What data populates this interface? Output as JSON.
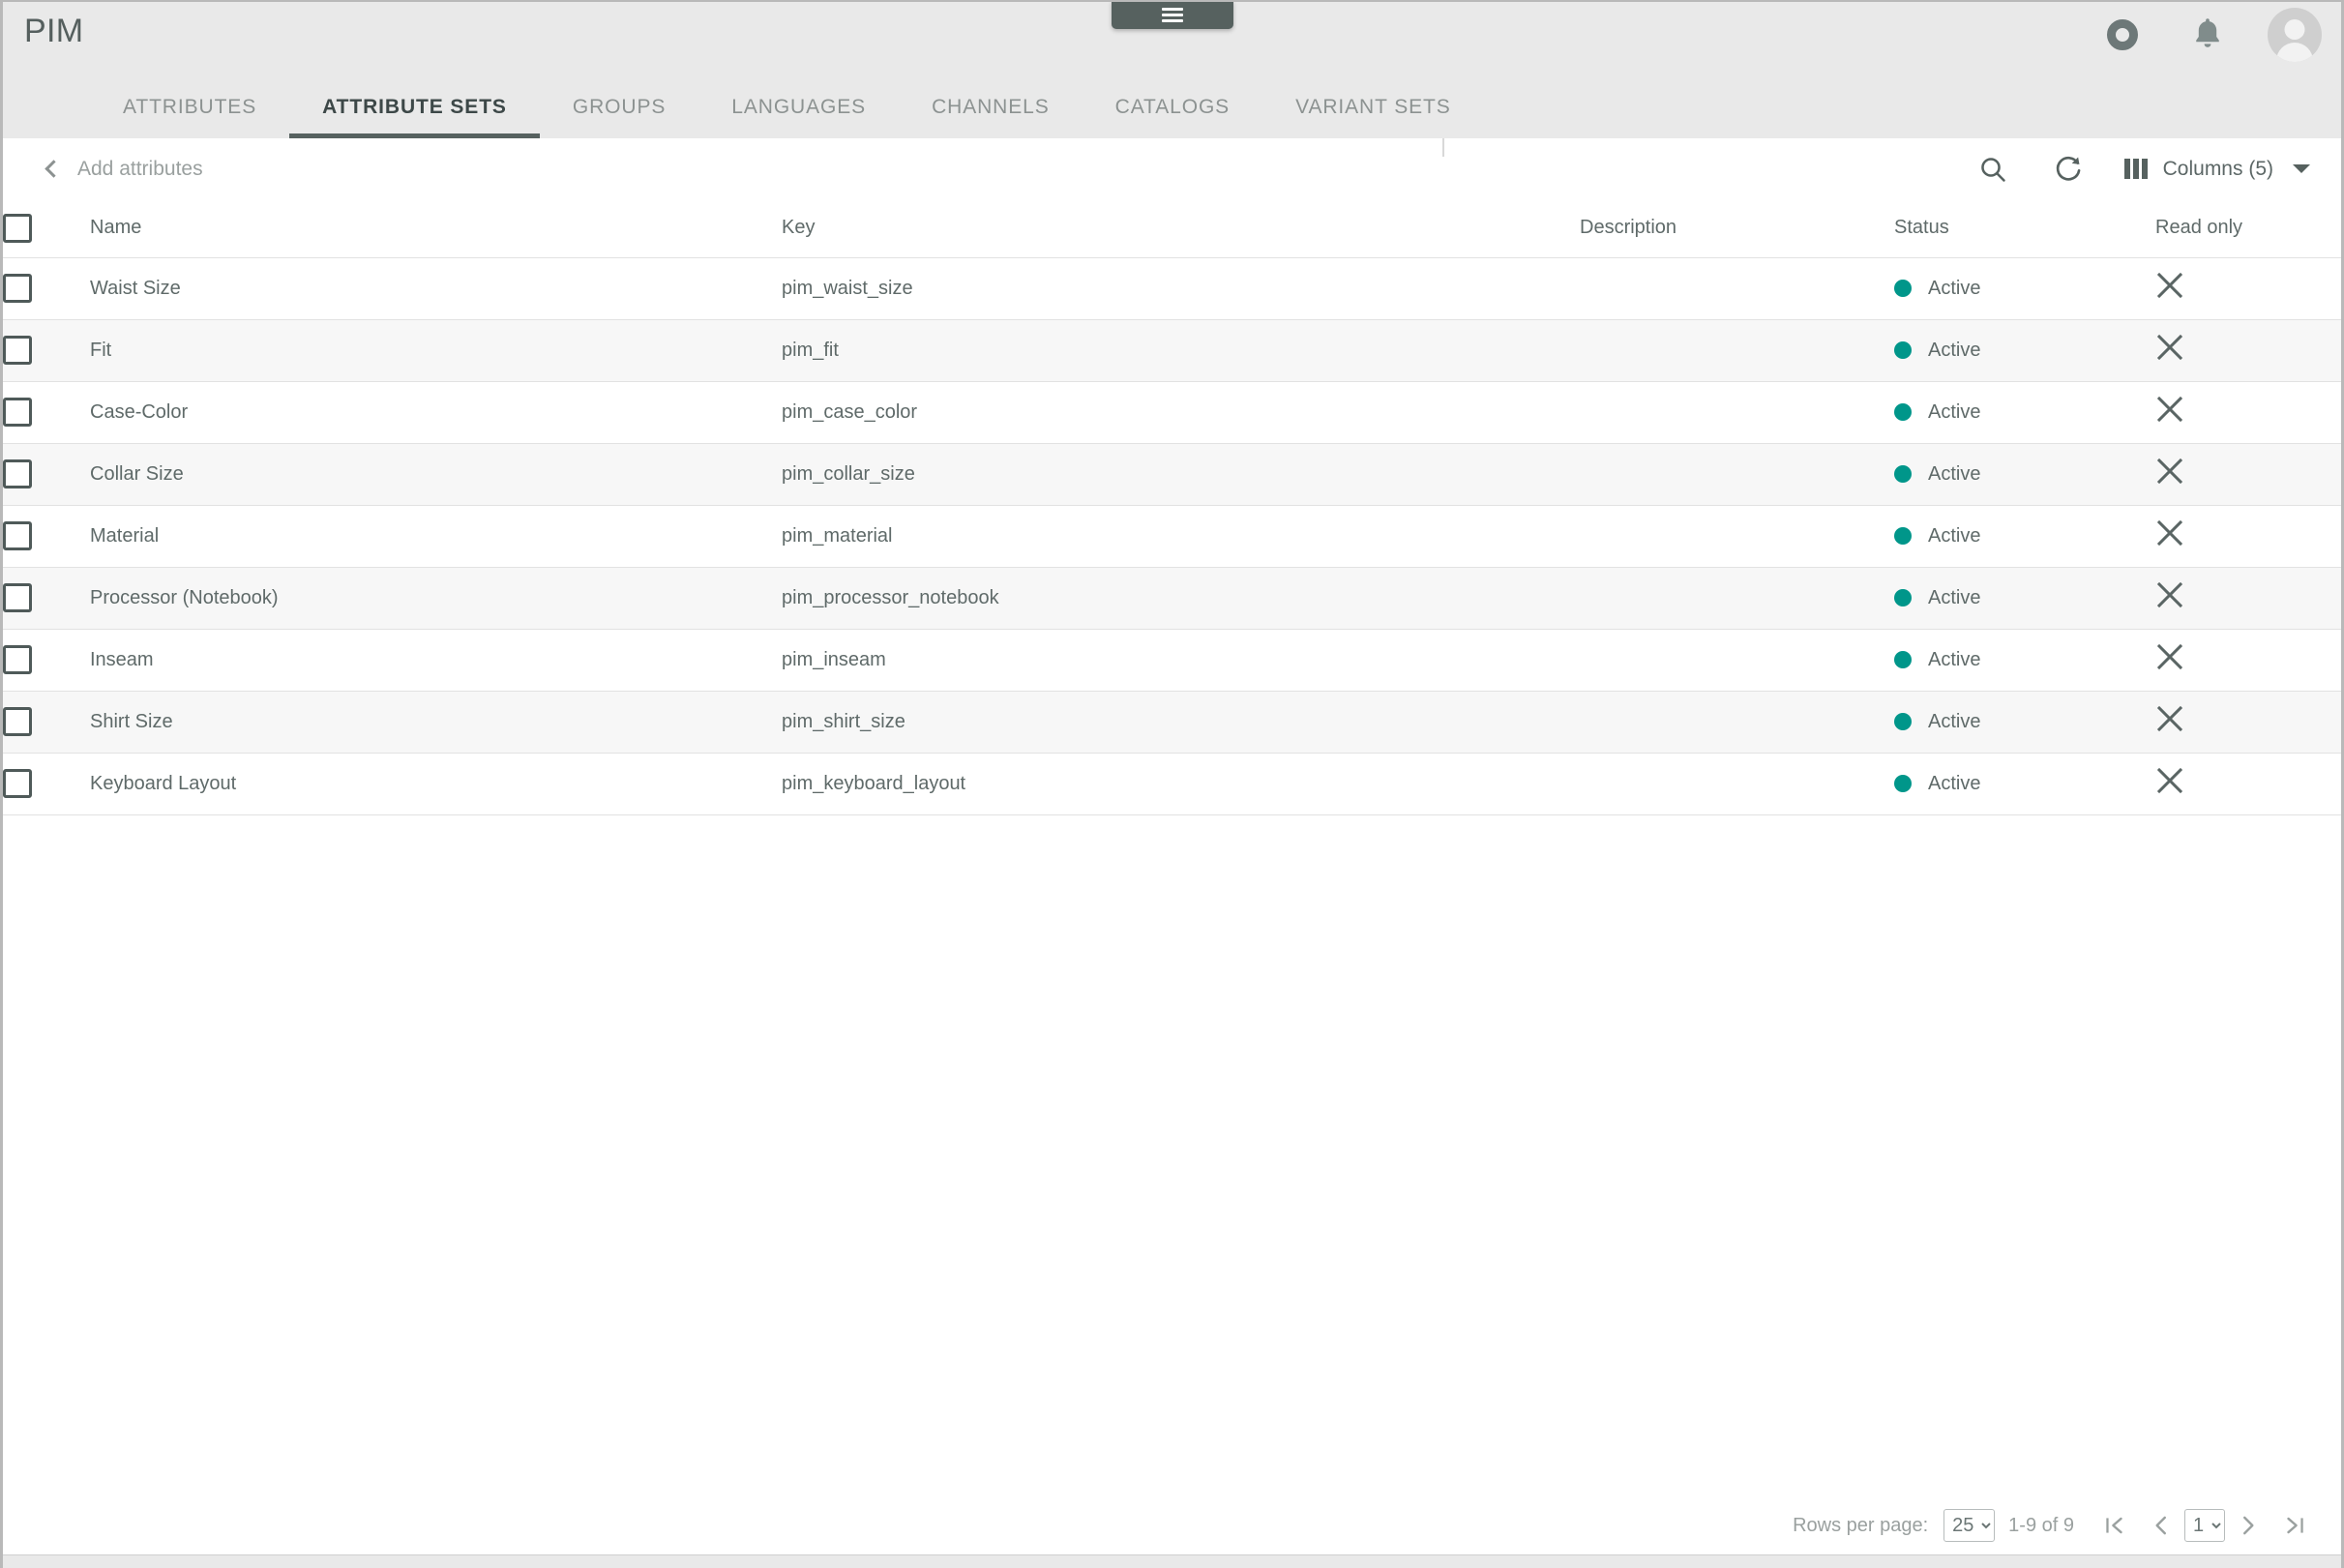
{
  "window": {
    "drag_handle_icon": "hamburger-menu-icon"
  },
  "appbar": {
    "title": "PIM",
    "actions": [
      {
        "name": "ring-icon",
        "label": ""
      },
      {
        "name": "bell-icon",
        "label": ""
      },
      {
        "name": "avatar",
        "label": ""
      }
    ]
  },
  "tabs": [
    {
      "label": "ATTRIBUTES",
      "active": false
    },
    {
      "label": "ATTRIBUTE SETS",
      "active": true
    },
    {
      "label": "GROUPS",
      "active": false
    },
    {
      "label": "LANGUAGES",
      "active": false
    },
    {
      "label": "CHANNELS",
      "active": false
    },
    {
      "label": "CATALOGS",
      "active": false
    },
    {
      "label": "VARIANT SETS",
      "active": false
    }
  ],
  "subtoolbar": {
    "back_label": "Add attributes",
    "search_icon": "search-icon",
    "refresh_icon": "refresh-icon",
    "columns_icon": "columns-icon",
    "columns_label": "Columns (5)"
  },
  "table": {
    "headers": {
      "name": "Name",
      "key": "Key",
      "description": "Description",
      "status": "Status",
      "read_only": "Read only"
    },
    "rows": [
      {
        "name": "Waist Size",
        "key": "pim_waist_size",
        "description": "",
        "status": "Active",
        "read_only": "x-icon"
      },
      {
        "name": "Fit",
        "key": "pim_fit",
        "description": "",
        "status": "Active",
        "read_only": "x-icon"
      },
      {
        "name": "Case-Color",
        "key": "pim_case_color",
        "description": "",
        "status": "Active",
        "read_only": "x-icon"
      },
      {
        "name": "Collar Size",
        "key": "pim_collar_size",
        "description": "",
        "status": "Active",
        "read_only": "x-icon"
      },
      {
        "name": "Material",
        "key": "pim_material",
        "description": "",
        "status": "Active",
        "read_only": "x-icon"
      },
      {
        "name": "Processor (Notebook)",
        "key": "pim_processor_notebook",
        "description": "",
        "status": "Active",
        "read_only": "x-icon"
      },
      {
        "name": "Inseam",
        "key": "pim_inseam",
        "description": "",
        "status": "Active",
        "read_only": "x-icon"
      },
      {
        "name": "Shirt Size",
        "key": "pim_shirt_size",
        "description": "",
        "status": "Active",
        "read_only": "x-icon"
      },
      {
        "name": "Keyboard Layout",
        "key": "pim_keyboard_layout",
        "description": "",
        "status": "Active",
        "read_only": "x-icon"
      }
    ]
  },
  "footer": {
    "rows_per_page_label": "Rows per page:",
    "rows_per_page_value": "25",
    "rows_per_page_options": [
      "25"
    ],
    "range_label": "1-9 of 9",
    "page_value": "1",
    "page_options": [
      "1"
    ],
    "first_page_icon": "first-page-icon",
    "prev_page_icon": "previous-page-icon",
    "next_page_icon": "next-page-icon",
    "last_page_icon": "last-page-icon"
  },
  "colors": {
    "accent_status": "#00968a",
    "appbar_bg": "#e9e9e9",
    "tab_active": "#3d4848",
    "text_primary": "#5f6a69",
    "text_muted": "#9aa09f"
  }
}
